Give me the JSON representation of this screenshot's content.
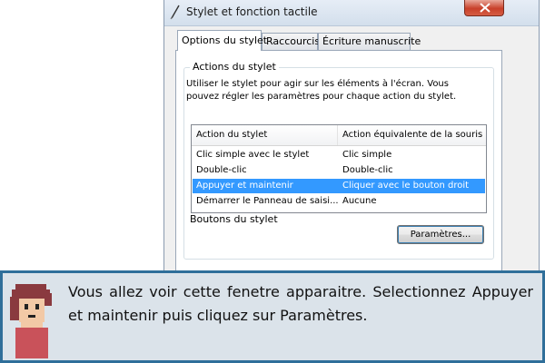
{
  "window": {
    "title": "Stylet et fonction tactile",
    "close_icon": "close-icon"
  },
  "tabs": [
    {
      "label": "Options du stylet",
      "active": true
    },
    {
      "label": "Raccourcis",
      "active": false
    },
    {
      "label": "Écriture manuscrite",
      "active": false
    }
  ],
  "group": {
    "title": "Actions du stylet",
    "description": "Utiliser le stylet pour agir sur les éléments à l'écran. Vous pouvez régler les paramètres pour chaque action du stylet."
  },
  "listview": {
    "headers": [
      "Action du stylet",
      "Action équivalente de la souris"
    ],
    "rows": [
      {
        "action": "Clic simple avec le stylet",
        "mouse": "Clic simple",
        "selected": false
      },
      {
        "action": "Double-clic",
        "mouse": "Double-clic",
        "selected": false
      },
      {
        "action": "Appuyer et maintenir",
        "mouse": "Cliquer avec le bouton droit",
        "selected": true
      },
      {
        "action": "Démarrer le Panneau de saisi...",
        "mouse": "Aucune",
        "selected": false
      }
    ]
  },
  "settings_button": "Paramètres...",
  "group2_title": "Boutons du stylet",
  "caption": {
    "text": "Vous allez voir cette fenetre apparaitre. Selectionnez Appuyer et maintenir puis cliquez sur Paramètres."
  },
  "colors": {
    "selection": "#3399ff",
    "caption_border": "#2f6f9a",
    "caption_bg": "#dbe3ea"
  }
}
